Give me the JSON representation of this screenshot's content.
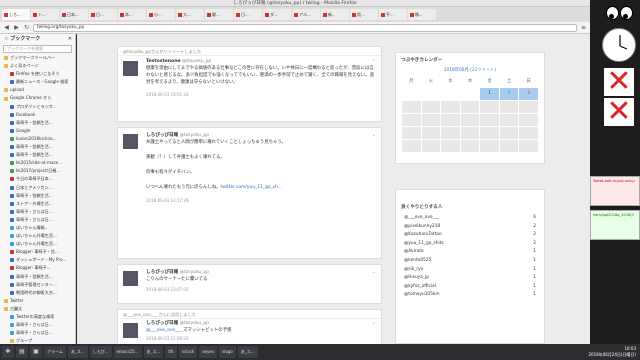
{
  "window": {
    "title": "しろぴっぴ日報 (@tosyoku_pp) / twilog - Mozilla Firefox"
  },
  "tabs": [
    {
      "label": "しろ..."
    },
    {
      "label": "ト..."
    },
    {
      "label": "日本..."
    },
    {
      "label": "日..."
    },
    {
      "label": "本..."
    },
    {
      "label": "小..."
    },
    {
      "label": "大..."
    },
    {
      "label": "最..."
    },
    {
      "label": "日..."
    },
    {
      "label": "ダ..."
    },
    {
      "label": "アル..."
    },
    {
      "label": "新.."
    },
    {
      "label": "読..."
    },
    {
      "label": "平..."
    },
    {
      "label": "株..."
    }
  ],
  "navbar": {
    "url": "twilog.org/tosyoku_pp"
  },
  "sidebar": {
    "title": "ブックマーク",
    "search_placeholder": "ブックマークを検索",
    "items": [
      {
        "label": "ブックマークツールバー",
        "icon": "folder-icon",
        "c": "f"
      },
      {
        "label": "よく見るページ",
        "icon": "folder-icon",
        "c": "f"
      },
      {
        "label": "Firefox を使いこなそう",
        "icon": "firefox-icon",
        "c": "r"
      },
      {
        "label": "最新ニュース - Google 検索",
        "icon": "google-icon",
        "c": "b"
      },
      {
        "label": "upload",
        "icon": "folder-icon",
        "c": "f"
      },
      {
        "label": "Google Chrome から",
        "icon": "folder-icon",
        "c": "f"
      },
      {
        "label": "プロダクトとラジオ...",
        "icon": "page-icon",
        "c": "b"
      },
      {
        "label": "Facebook",
        "icon": "facebook-icon",
        "c": "b"
      },
      {
        "label": "車椅子・信頼生活...",
        "icon": "page-icon",
        "c": "b"
      },
      {
        "label": "Google",
        "icon": "google-icon",
        "c": "b"
      },
      {
        "label": "kuroni2018kichiro...",
        "icon": "page-icon",
        "c": "g"
      },
      {
        "label": "車椅子・信頼生活...",
        "icon": "page-icon",
        "c": "b"
      },
      {
        "label": "車椅子・信頼生活...",
        "icon": "page-icon",
        "c": "b"
      },
      {
        "label": "kk2015/site-at-maze...",
        "icon": "page-icon",
        "c": "g"
      },
      {
        "label": "kk2017/project/日報...",
        "icon": "page-icon",
        "c": "g"
      },
      {
        "label": "今日の車椅子日本...",
        "icon": "page-icon",
        "c": "r"
      },
      {
        "label": "日本とアメリカン...",
        "icon": "page-icon",
        "c": "b"
      },
      {
        "label": "車椅子・信頼生活...",
        "icon": "page-icon",
        "c": "b"
      },
      {
        "label": "ストア・外場生活...",
        "icon": "page-icon",
        "c": "b"
      },
      {
        "label": "車椅子・さらば日...",
        "icon": "page-icon",
        "c": "b"
      },
      {
        "label": "車椅子・さらば日...",
        "icon": "page-icon",
        "c": "b"
      },
      {
        "label": "ほいちゃん情報...",
        "icon": "page-icon",
        "c": "t"
      },
      {
        "label": "ほいちゃん外場生活...",
        "icon": "page-icon",
        "c": "t"
      },
      {
        "label": "ほいちゃん外場生活...",
        "icon": "page-icon",
        "c": "t"
      },
      {
        "label": "Blogger: 車椅子・信...",
        "icon": "blogger-icon",
        "c": "r"
      },
      {
        "label": "ダッシュボード - My Pro...",
        "icon": "page-icon",
        "c": "b"
      },
      {
        "label": "Blogger: 車椅子...",
        "icon": "blogger-icon",
        "c": "r"
      },
      {
        "label": "車椅子・信頼生活...",
        "icon": "page-icon",
        "c": "b"
      },
      {
        "label": "車椅子管理センター...",
        "icon": "page-icon",
        "c": "b"
      },
      {
        "label": "戦国時代の御術大名...",
        "icon": "page-icon",
        "c": "b"
      },
      {
        "label": "Twitter",
        "icon": "folder-icon",
        "c": "f"
      },
      {
        "label": "古麗太",
        "icon": "folder-icon",
        "c": "f"
      },
      {
        "label": "Twitterの高度な検索",
        "icon": "twitter-icon",
        "c": "t"
      },
      {
        "label": "車椅子・さらば日...",
        "icon": "twitter-icon",
        "c": "t"
      },
      {
        "label": "車椅子・さらば日...",
        "icon": "twitter-icon",
        "c": "t"
      },
      {
        "label": "グループ",
        "icon": "folder-icon",
        "c": "f"
      },
      {
        "label": "保護者的tkika...",
        "icon": "page-icon",
        "c": "b"
      }
    ]
  },
  "cards": [
    {
      "header": "@tosyoku_ppさんがリツイートしました",
      "name": "Testostenone",
      "handle": "@tosyoku_pp",
      "text": "健康を理由にしてまでやる価値のある仕事などこの世に存在しない。いや休日に一度構わると思ったが、普段には言わないと感じるな。多少負担度でも強くなってでもいい、肥満の一歩手前で止めて寝く、全ての職場を見えない。過労を考えるより、健康は守らないといけない。",
      "date": "2018-06-03 18:01:33"
    },
    {
      "header": "",
      "name": "しろぴっぴ日報",
      "handle": "@tosyoku_pp",
      "line1": "弁護士やってると人間が簡単に壊れていくことしょっちゅう見ちゃう。",
      "line2": "楽観（？）して弁護士もよく壊れてる。",
      "line3": "何事も程々がイチバン。",
      "line4": "いつへん壊れたもう元に戻らんしね。",
      "link": "twitter.com/yuu_11_go_sh...",
      "date": "2018-06-03 10:17:29"
    },
    {
      "header": "",
      "name": "しろぴっぴ日報",
      "handle": "@tosyoku_pp",
      "text": "こりんのサーナーたに驚いてる",
      "date": "2018-06-03 23:07:03"
    },
    {
      "header": "@___ovo_ovo___ さんに返信しました",
      "name": "しろぴっぴ日報",
      "handle": "@tosyoku_pp",
      "mention": "@___ovo_ovo___",
      "text": "ズマッシャビットの予感",
      "date": "2018-06-03 21:26:20"
    }
  ],
  "calendar": {
    "title": "つぶやきカレンダー",
    "month": "2018年06月 (21ツイート)",
    "dows": [
      "月",
      "火",
      "水",
      "木",
      "金",
      "土",
      "日"
    ],
    "days": [
      "",
      "",
      "",
      "",
      "1",
      "2",
      "3",
      "",
      "",
      "",
      "",
      "",
      "",
      "",
      "",
      "",
      "",
      "",
      "",
      "",
      "",
      "",
      "",
      "",
      "",
      "",
      "",
      "",
      "",
      "",
      "",
      "",
      "",
      "",
      ""
    ]
  },
  "ranking": {
    "title": "良くやりとりする人",
    "rows": [
      {
        "name": "@___ovo_ovo___",
        "count": "6"
      },
      {
        "name": "@pixelbunny218",
        "count": "2"
      },
      {
        "name": "@KazuharuTattoo",
        "count": "2"
      },
      {
        "name": "@yuu_11_go_shits",
        "count": "2"
      },
      {
        "name": "@Akirato",
        "count": "1"
      },
      {
        "name": "@kenta0525",
        "count": "1"
      },
      {
        "name": "@sik_ryo",
        "count": "1"
      },
      {
        "name": "@Hisuya_jp",
        "count": "1"
      },
      {
        "name": "@kyfoz_official",
        "count": "1"
      },
      {
        "name": "@tomoyu105km",
        "count": "1"
      }
    ]
  },
  "desktop": {
    "term1": "Tweet-add-mysql-uniq.r",
    "term2": "twmysql2018a_2018(Y"
  },
  "taskbar": {
    "items": [
      "アラーム",
      "あ_ス...",
      "しろぴ...",
      "emacs25...",
      "あ_ス...",
      "tfk",
      "xclock",
      "xeyes",
      "xlogo",
      "あ_ス..."
    ],
    "time": "18:03",
    "date": "2018年06月24日(日曜日)"
  }
}
